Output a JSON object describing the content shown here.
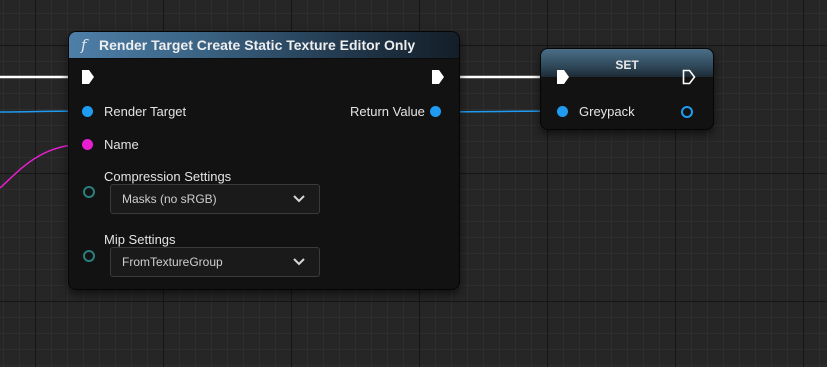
{
  "function_node": {
    "icon": "function-f-icon",
    "icon_glyph": "f",
    "title": "Render Target Create Static Texture Editor Only",
    "inputs": {
      "render_target": "Render Target",
      "name": "Name",
      "compression_settings": {
        "label": "Compression Settings",
        "value": "Masks (no sRGB)"
      },
      "mip_settings": {
        "label": "Mip Settings",
        "value": "FromTextureGroup"
      }
    },
    "outputs": {
      "return_value": "Return Value"
    }
  },
  "set_node": {
    "title": "SET",
    "variable": "Greypack"
  },
  "colors": {
    "object_pin": "#1f9cf2",
    "string_pin": "#e81ed1",
    "enum_pin": "#2b7f7c",
    "exec_pin": "#ffffff",
    "function_header": "#3a6282"
  }
}
